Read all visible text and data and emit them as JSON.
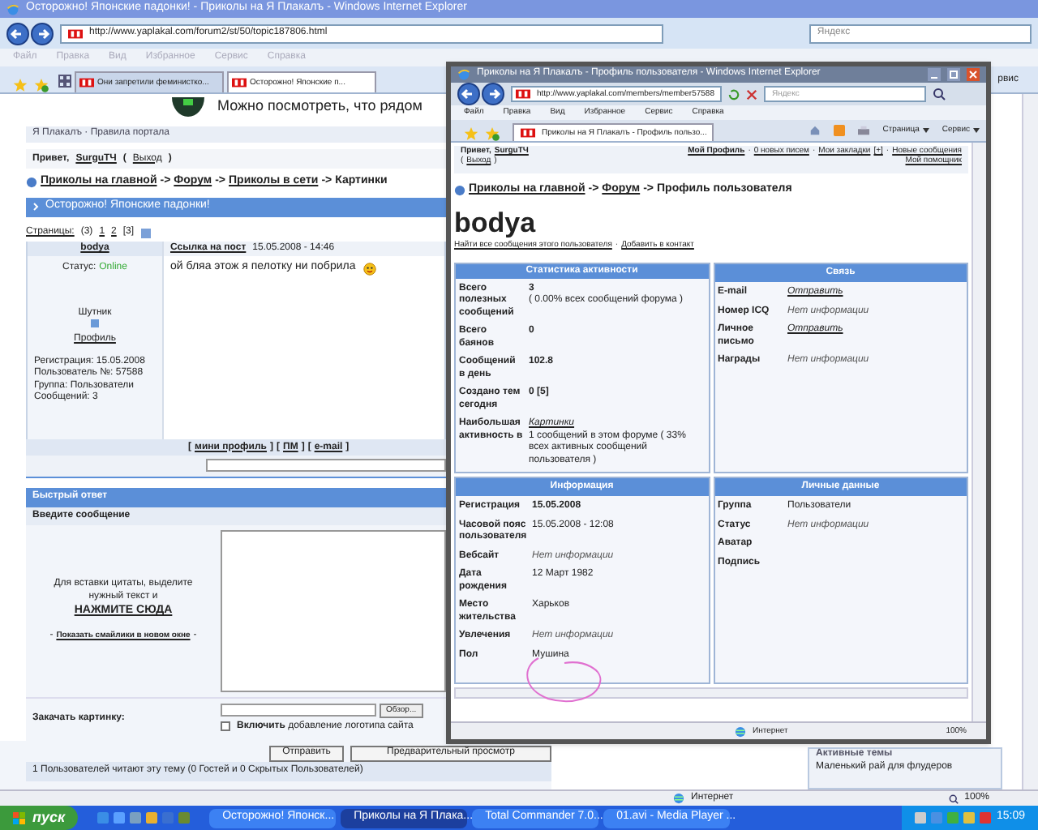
{
  "left_window": {
    "title": "Осторожно! Японские падонки! - Приколы на Я Плакалъ - Windows Internet Explorer",
    "address": "http://www.yaplakal.com/forum2/st/50/topic187806.html",
    "search_placeholder": "Яндекс",
    "menu": [
      "Файл",
      "Правка",
      "Вид",
      "Избранное",
      "Сервис",
      "Справка"
    ],
    "tabs": [
      {
        "label": "Они запретили феминистко...",
        "selected": false
      },
      {
        "label": "Осторожно! Японские п...",
        "selected": true
      }
    ],
    "toolbar_fragment": "рвис",
    "banner": "Можно посмотреть, что рядом",
    "portal_links": "Я Плакалъ · Правила портала",
    "greeting": {
      "text": "Привет,",
      "user": "SurguTЧ",
      "open": "(",
      "logout": "Выход",
      "close": ")"
    },
    "breadcrumbs": [
      "Приколы на главной",
      "Форум",
      "Приколы в сети",
      "Картинки"
    ],
    "breadcrumb_separator": "->",
    "topic_title": "Осторожно! Японские падонки!",
    "pages": {
      "label": "Страницы:",
      "count": "(3)",
      "items": [
        {
          "label": "1",
          "selected": false
        },
        {
          "label": "2",
          "selected": false
        },
        {
          "label": "[3]",
          "selected": true
        }
      ]
    },
    "post": {
      "author": "bodya",
      "status_label": "Статус:",
      "status": "Online",
      "online": true,
      "rank": "Шутник",
      "profile_link": "Профиль",
      "details": [
        "Регистрация: 15.05.2008",
        "Пользователь №: 57588",
        "Группа: Пользователи",
        "Сообщений: 3"
      ],
      "post_link": "Ссылка на пост",
      "date": "15.05.2008 - 14:46",
      "text": "ой бляа этож я пелотку ни побрила",
      "footer_links": [
        "мини профиль",
        "ПМ",
        "e-mail"
      ],
      "bracket_open": "[",
      "bracket_close": "]"
    },
    "quick_reply": {
      "title": "Быстрый ответ",
      "subtitle": "Введите сообщение",
      "hint": "Для вставки цитаты, выделите нужный текст и",
      "quote_link": "НАЖМИТЕ СЮДА",
      "smileys_link": "Показать смайлики в новом окне",
      "dash": "-",
      "upload_label": "Закачать картинку:",
      "browse": "Обзор...",
      "logo_checkbox": {
        "label": "**Включить** добавление логотипа сайта",
        "checked": false
      },
      "buttons": [
        "Отправить",
        "Предварительный просмотр"
      ]
    },
    "readers": "1 Пользователей читают эту тему (0 Гостей и 0 Скрытых Пользователей)",
    "active_topics": {
      "title": "Активные темы",
      "items": [
        "Маленький рай для флудеров"
      ]
    },
    "status": {
      "zone": "Интернет",
      "zoom": "100%"
    }
  },
  "right_window": {
    "title": "Приколы на Я Плакалъ - Профиль пользователя - Windows Internet Explorer",
    "address": "http://www.yaplakal.com/members/member57588",
    "search_placeholder": "Яндекс",
    "menu": [
      "Файл",
      "Правка",
      "Вид",
      "Избранное",
      "Сервис",
      "Справка"
    ],
    "tabs": [
      {
        "label": "Приколы на Я Плакалъ - Профиль пользо...",
        "selected": true
      }
    ],
    "toolbar": [
      "Страница",
      "Сервис"
    ],
    "greeting": {
      "text": "Привет,",
      "user": "SurguTЧ",
      "open": "(",
      "logout": "Выход",
      "close": ")"
    },
    "separator": "·",
    "user_links": [
      "Мой Профиль",
      "0 новых писем",
      "Мои закладки",
      "[+]",
      "Новые сообщения",
      "Мой помощник"
    ],
    "breadcrumbs": [
      "Приколы на главной",
      "Форум",
      "Профиль пользователя"
    ],
    "breadcrumb_separator": "->",
    "username": "bodya",
    "profile_links": [
      "Найти все сообщения этого пользователя",
      "Добавить в контакт"
    ],
    "panels": [
      {
        "title": "Статистика активности",
        "rows": [
          {
            "label": "Всего полезных сообщений",
            "value": "3",
            "note": "( 0.00% всех сообщений форума )",
            "kind": "strong"
          },
          {
            "label": "Всего баянов",
            "value": "0",
            "kind": "strong"
          },
          {
            "label": "Сообщений в день",
            "value": "102.8",
            "kind": "strong"
          },
          {
            "label": "Создано тем сегодня",
            "value": "0 [5]",
            "kind": "strong"
          },
          {
            "label": "Наибольшая активность в",
            "value": "Картинки",
            "note": "1 сообщений в этом форуме ( 33% всех активных сообщений пользователя )",
            "kind": "link"
          }
        ]
      },
      {
        "title": "Связь",
        "rows": [
          {
            "label": "E-mail",
            "value": "Отправить",
            "kind": "link"
          },
          {
            "label": "Номер ICQ",
            "value": "Нет информации",
            "kind": "missing"
          },
          {
            "label": "Личное письмо",
            "value": "Отправить",
            "kind": "link"
          },
          {
            "label": "Награды",
            "value": "Нет информации",
            "kind": "missing"
          }
        ]
      },
      {
        "title": "Информация",
        "rows": [
          {
            "label": "Регистрация",
            "value": "15.05.2008",
            "kind": "strong"
          },
          {
            "label": "Часовой пояс пользователя",
            "value": "15.05.2008 - 12:08",
            "kind": "text"
          },
          {
            "label": "Вебсайт",
            "value": "Нет информации",
            "kind": "missing"
          },
          {
            "label": "Дата рождения",
            "value": "12 Март 1982",
            "kind": "text"
          },
          {
            "label": "Место жительства",
            "value": "Харьков",
            "kind": "text"
          },
          {
            "label": "Увлечения",
            "value": "Нет информации",
            "kind": "missing"
          },
          {
            "label": "Пол",
            "value": "Мушина",
            "kind": "text"
          }
        ]
      },
      {
        "title": "Личные данные",
        "rows": [
          {
            "label": "Группа",
            "value": "Пользователи",
            "kind": "text"
          },
          {
            "label": "Статус",
            "value": "Нет информации",
            "kind": "missing"
          },
          {
            "label": "Аватар"
          },
          {
            "label": "Подпись"
          }
        ]
      }
    ],
    "status": {
      "zone": "Интернет",
      "zoom": "100%"
    }
  },
  "taskbar": {
    "start": "пуск",
    "tasks": [
      {
        "label": "Осторожно! Японск...",
        "selected": false
      },
      {
        "label": "Приколы на Я Плака...",
        "selected": true
      },
      {
        "label": "Total Commander 7.0...",
        "selected": false
      },
      {
        "label": "01.avi - Media Player ...",
        "selected": false
      }
    ],
    "clock": "15:09"
  }
}
